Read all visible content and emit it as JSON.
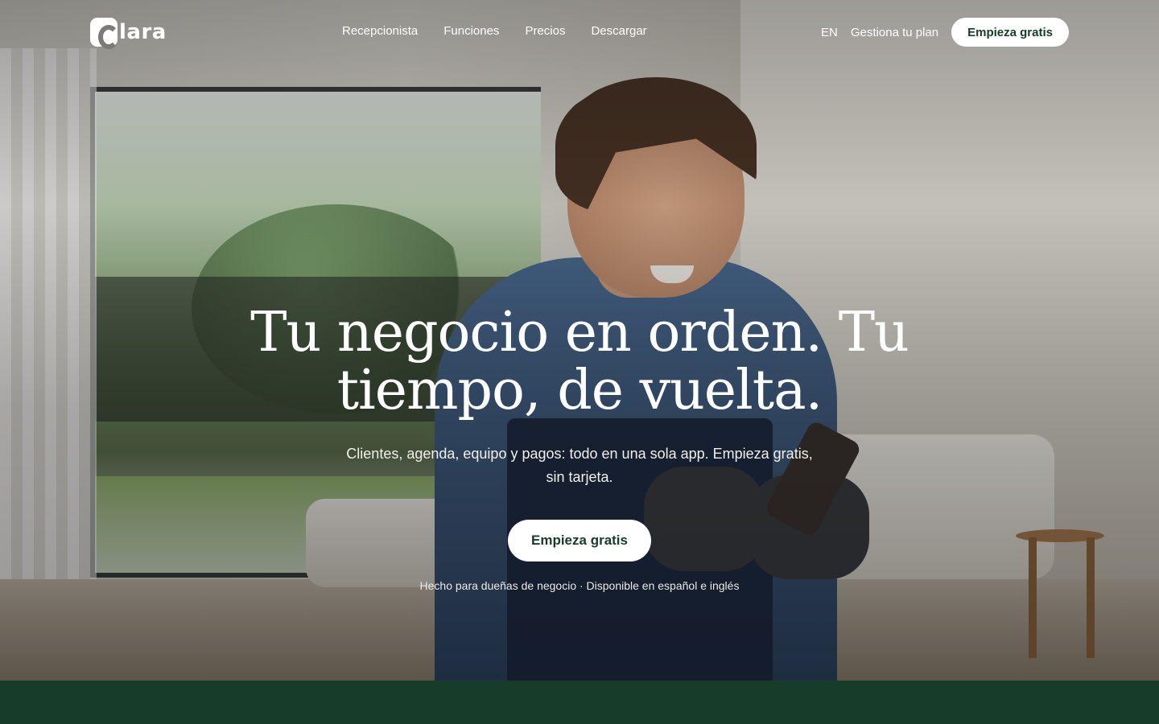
{
  "brand": {
    "logo_text": "lara",
    "accent_color": "#173d2a"
  },
  "nav": {
    "links": [
      "Recepcionista",
      "Funciones",
      "Precios",
      "Descargar"
    ],
    "language": "EN",
    "manage_plan": "Gestiona tu plan",
    "cta": "Empieza gratis"
  },
  "hero": {
    "headline": "Tu negocio en orden. Tu tiempo, de vuelta.",
    "subtitle": "Clientes, agenda, equipo y pagos: todo en una sola app. Empieza gratis, sin tarjeta.",
    "cta": "Empieza gratis",
    "footnote": "Hecho para dueñas de negocio · Disponible en español e inglés"
  }
}
